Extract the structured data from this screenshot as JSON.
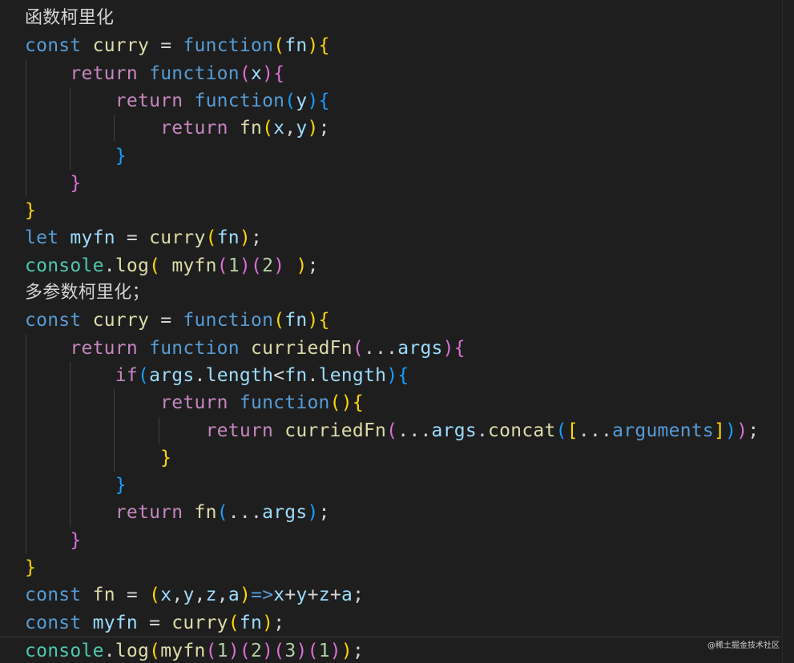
{
  "editor": {
    "lines": [
      {
        "kind": "comment",
        "tokens": [
          [
            "c",
            "函数柯里化"
          ]
        ]
      },
      {
        "kind": "code",
        "tokens": [
          [
            "kw",
            "const"
          ],
          [
            "op",
            " "
          ],
          [
            "fn",
            "curry"
          ],
          [
            "op",
            " = "
          ],
          [
            "kw",
            "function"
          ],
          [
            "br1",
            "("
          ],
          [
            "var",
            "fn"
          ],
          [
            "br1",
            ")"
          ],
          [
            "br1",
            "{"
          ]
        ]
      },
      {
        "kind": "code",
        "tokens": [
          [
            "op",
            "    "
          ],
          [
            "ctrl",
            "return"
          ],
          [
            "op",
            " "
          ],
          [
            "kw",
            "function"
          ],
          [
            "br2",
            "("
          ],
          [
            "var",
            "x"
          ],
          [
            "br2",
            ")"
          ],
          [
            "br2",
            "{"
          ]
        ]
      },
      {
        "kind": "code",
        "tokens": [
          [
            "op",
            "        "
          ],
          [
            "ctrl",
            "return"
          ],
          [
            "op",
            " "
          ],
          [
            "kw",
            "function"
          ],
          [
            "br3",
            "("
          ],
          [
            "var",
            "y"
          ],
          [
            "br3",
            ")"
          ],
          [
            "br3",
            "{"
          ]
        ]
      },
      {
        "kind": "code",
        "tokens": [
          [
            "op",
            "            "
          ],
          [
            "ctrl",
            "return"
          ],
          [
            "op",
            " "
          ],
          [
            "fn",
            "fn"
          ],
          [
            "br1",
            "("
          ],
          [
            "var",
            "x"
          ],
          [
            "op",
            ","
          ],
          [
            "var",
            "y"
          ],
          [
            "br1",
            ")"
          ],
          [
            "op",
            ";"
          ]
        ]
      },
      {
        "kind": "code",
        "tokens": [
          [
            "op",
            "        "
          ],
          [
            "br3",
            "}"
          ]
        ]
      },
      {
        "kind": "code",
        "tokens": [
          [
            "op",
            "    "
          ],
          [
            "br2",
            "}"
          ]
        ]
      },
      {
        "kind": "code",
        "tokens": [
          [
            "br1",
            "}"
          ]
        ]
      },
      {
        "kind": "code",
        "tokens": [
          [
            "kw",
            "let"
          ],
          [
            "op",
            " "
          ],
          [
            "var",
            "myfn"
          ],
          [
            "op",
            " = "
          ],
          [
            "fn",
            "curry"
          ],
          [
            "br1",
            "("
          ],
          [
            "var",
            "fn"
          ],
          [
            "br1",
            ")"
          ],
          [
            "op",
            ";"
          ]
        ]
      },
      {
        "kind": "code",
        "tokens": [
          [
            "cls",
            "console"
          ],
          [
            "op",
            "."
          ],
          [
            "fn",
            "log"
          ],
          [
            "br1",
            "("
          ],
          [
            "op",
            " "
          ],
          [
            "fn",
            "myfn"
          ],
          [
            "br2",
            "("
          ],
          [
            "num",
            "1"
          ],
          [
            "br2",
            ")"
          ],
          [
            "br2",
            "("
          ],
          [
            "num",
            "2"
          ],
          [
            "br2",
            ")"
          ],
          [
            "op",
            " "
          ],
          [
            "br1",
            ")"
          ],
          [
            "op",
            ";"
          ]
        ]
      },
      {
        "kind": "comment",
        "tokens": [
          [
            "c",
            "多参数柯里化；"
          ]
        ]
      },
      {
        "kind": "code",
        "tokens": [
          [
            "kw",
            "const"
          ],
          [
            "op",
            " "
          ],
          [
            "fn",
            "curry"
          ],
          [
            "op",
            " = "
          ],
          [
            "kw",
            "function"
          ],
          [
            "br1",
            "("
          ],
          [
            "var",
            "fn"
          ],
          [
            "br1",
            ")"
          ],
          [
            "br1",
            "{"
          ]
        ]
      },
      {
        "kind": "code",
        "tokens": [
          [
            "op",
            "    "
          ],
          [
            "ctrl",
            "return"
          ],
          [
            "op",
            " "
          ],
          [
            "kw",
            "function"
          ],
          [
            "op",
            " "
          ],
          [
            "fn",
            "curriedFn"
          ],
          [
            "br2",
            "("
          ],
          [
            "op",
            "..."
          ],
          [
            "var",
            "args"
          ],
          [
            "br2",
            ")"
          ],
          [
            "br2",
            "{"
          ]
        ]
      },
      {
        "kind": "code",
        "tokens": [
          [
            "op",
            "        "
          ],
          [
            "ctrl",
            "if"
          ],
          [
            "br3",
            "("
          ],
          [
            "var",
            "args"
          ],
          [
            "op",
            "."
          ],
          [
            "var",
            "length"
          ],
          [
            "op",
            "<"
          ],
          [
            "var",
            "fn"
          ],
          [
            "op",
            "."
          ],
          [
            "var",
            "length"
          ],
          [
            "br3",
            ")"
          ],
          [
            "br3",
            "{"
          ]
        ]
      },
      {
        "kind": "code",
        "tokens": [
          [
            "op",
            "            "
          ],
          [
            "ctrl",
            "return"
          ],
          [
            "op",
            " "
          ],
          [
            "kw",
            "function"
          ],
          [
            "br1",
            "("
          ],
          [
            "br1",
            ")"
          ],
          [
            "br1",
            "{"
          ]
        ]
      },
      {
        "kind": "code",
        "tokens": [
          [
            "op",
            "                "
          ],
          [
            "ctrl",
            "return"
          ],
          [
            "op",
            " "
          ],
          [
            "fn",
            "curriedFn"
          ],
          [
            "br2",
            "("
          ],
          [
            "op",
            "..."
          ],
          [
            "var",
            "args"
          ],
          [
            "op",
            "."
          ],
          [
            "fn",
            "concat"
          ],
          [
            "br3",
            "("
          ],
          [
            "br1",
            "["
          ],
          [
            "op",
            "..."
          ],
          [
            "kw",
            "arguments"
          ],
          [
            "br1",
            "]"
          ],
          [
            "br3",
            ")"
          ],
          [
            "br2",
            ")"
          ],
          [
            "op",
            ";"
          ]
        ]
      },
      {
        "kind": "code",
        "tokens": [
          [
            "op",
            "            "
          ],
          [
            "br1",
            "}"
          ]
        ]
      },
      {
        "kind": "code",
        "tokens": [
          [
            "op",
            "        "
          ],
          [
            "br3",
            "}"
          ]
        ]
      },
      {
        "kind": "code",
        "tokens": [
          [
            "op",
            "        "
          ],
          [
            "ctrl",
            "return"
          ],
          [
            "op",
            " "
          ],
          [
            "fn",
            "fn"
          ],
          [
            "br3",
            "("
          ],
          [
            "op",
            "..."
          ],
          [
            "var",
            "args"
          ],
          [
            "br3",
            ")"
          ],
          [
            "op",
            ";"
          ]
        ]
      },
      {
        "kind": "code",
        "tokens": [
          [
            "op",
            "    "
          ],
          [
            "br2",
            "}"
          ]
        ]
      },
      {
        "kind": "code",
        "tokens": [
          [
            "br1",
            "}"
          ]
        ]
      },
      {
        "kind": "code",
        "tokens": [
          [
            "kw",
            "const"
          ],
          [
            "op",
            " "
          ],
          [
            "fn",
            "fn"
          ],
          [
            "op",
            " = "
          ],
          [
            "br1",
            "("
          ],
          [
            "var",
            "x"
          ],
          [
            "op",
            ","
          ],
          [
            "var",
            "y"
          ],
          [
            "op",
            ","
          ],
          [
            "var",
            "z"
          ],
          [
            "op",
            ","
          ],
          [
            "var",
            "a"
          ],
          [
            "br1",
            ")"
          ],
          [
            "kw",
            "=>"
          ],
          [
            "var",
            "x"
          ],
          [
            "op",
            "+"
          ],
          [
            "var",
            "y"
          ],
          [
            "op",
            "+"
          ],
          [
            "var",
            "z"
          ],
          [
            "op",
            "+"
          ],
          [
            "var",
            "a"
          ],
          [
            "op",
            ";"
          ]
        ]
      },
      {
        "kind": "code",
        "tokens": [
          [
            "kw",
            "const"
          ],
          [
            "op",
            " "
          ],
          [
            "var",
            "myfn"
          ],
          [
            "op",
            " = "
          ],
          [
            "fn",
            "curry"
          ],
          [
            "br1",
            "("
          ],
          [
            "var",
            "fn"
          ],
          [
            "br1",
            ")"
          ],
          [
            "op",
            ";"
          ]
        ]
      },
      {
        "kind": "code",
        "current": true,
        "tokens": [
          [
            "cls",
            "console"
          ],
          [
            "op",
            "."
          ],
          [
            "fn",
            "log"
          ],
          [
            "br1",
            "("
          ],
          [
            "fn",
            "myfn"
          ],
          [
            "br2",
            "("
          ],
          [
            "num",
            "1"
          ],
          [
            "br2",
            ")"
          ],
          [
            "br2",
            "("
          ],
          [
            "num",
            "2"
          ],
          [
            "br2",
            ")"
          ],
          [
            "br2",
            "("
          ],
          [
            "num",
            "3"
          ],
          [
            "br2",
            ")"
          ],
          [
            "br2",
            "("
          ],
          [
            "num",
            "1"
          ],
          [
            "br2",
            ")"
          ],
          [
            "br1",
            ")"
          ],
          [
            "op",
            ";"
          ]
        ]
      }
    ]
  },
  "watermark": "@稀土掘金技术社区"
}
